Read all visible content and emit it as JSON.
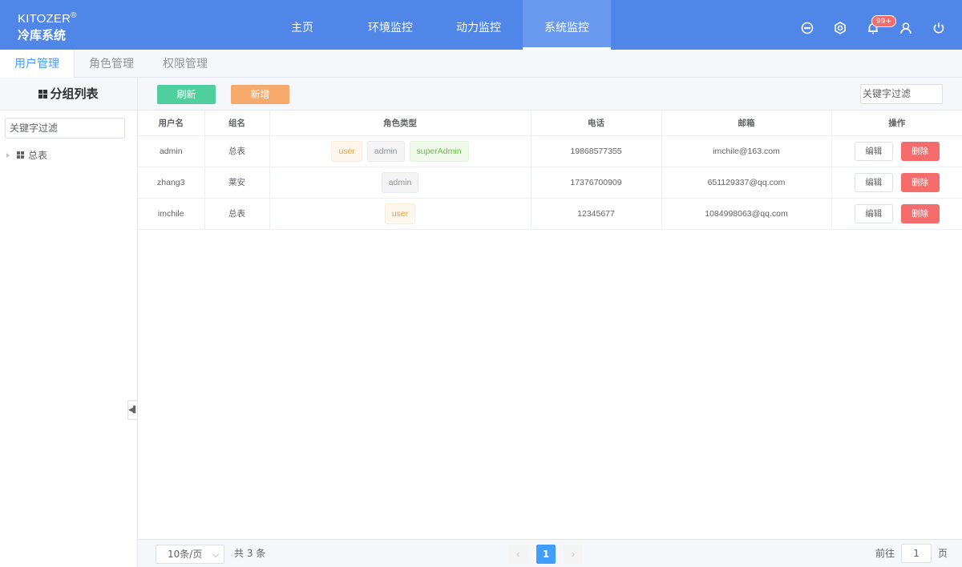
{
  "brand": {
    "name": "KITOZER",
    "reg": "®",
    "system": "冷库系统"
  },
  "nav": [
    "主页",
    "环境监控",
    "动力监控",
    "系统监控"
  ],
  "nav_active": "系统监控",
  "header_icons": [
    "chat-icon",
    "settings-icon",
    "bell-icon",
    "user-icon",
    "power-icon"
  ],
  "notifications_badge": "99+",
  "tabs": [
    "用户管理",
    "角色管理",
    "权限管理"
  ],
  "tabs_active": "用户管理",
  "left": {
    "title": "分组列表",
    "filter_placeholder": "关键字过滤",
    "tree": [
      {
        "label": "总表"
      }
    ]
  },
  "toolbar": {
    "refresh_label": "刷新",
    "add_label": "新增",
    "search_placeholder": "关键字过滤"
  },
  "table": {
    "headers": [
      "用户名",
      "组名",
      "角色类型",
      "电话",
      "邮箱",
      "操作"
    ],
    "rows": [
      {
        "username": "admin",
        "group": "总表",
        "roles": [
          "user",
          "admin",
          "superAdmin"
        ],
        "phone": "19868577355",
        "email": "imchile@163.com"
      },
      {
        "username": "zhang3",
        "group": "莱安",
        "roles": [
          "admin"
        ],
        "phone": "17376700909",
        "email": "651129337@qq.com"
      },
      {
        "username": "imchile",
        "group": "总表",
        "roles": [
          "user"
        ],
        "phone": "12345677",
        "email": "1084998063@qq.com"
      }
    ],
    "edit_label": "编辑",
    "delete_label": "删除"
  },
  "pagination": {
    "page_size": "10条/页",
    "total": "共 3 条",
    "current": "1",
    "goto_prefix": "前往",
    "goto_value": "1",
    "goto_suffix": "页"
  },
  "colors": {
    "header": "#5086e8",
    "primary": "#409eff",
    "refresh": "#4fcf9e",
    "add": "#f5a96b",
    "danger": "#f56c6c"
  }
}
